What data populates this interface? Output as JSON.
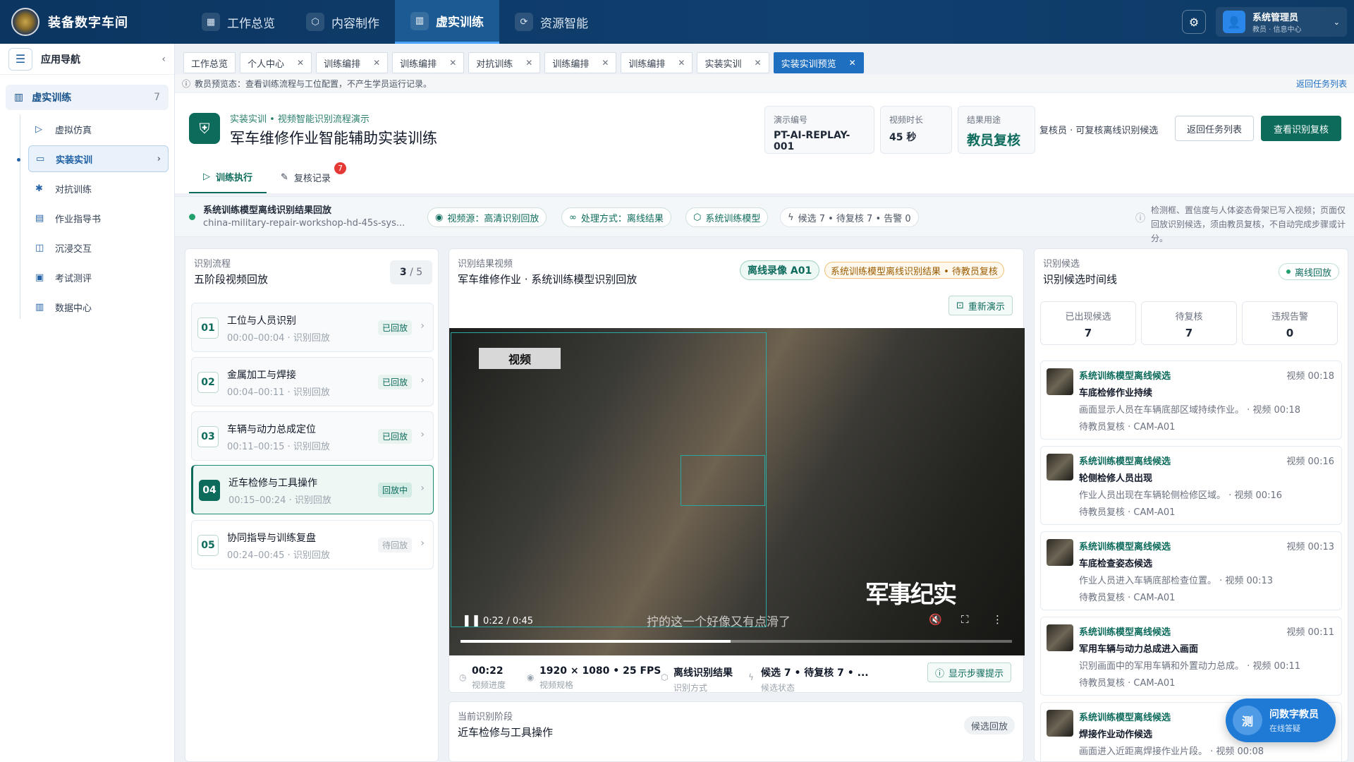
{
  "app": {
    "title": "装备数字车间"
  },
  "nav": [
    {
      "label": "工作总览",
      "icon": "grid-icon"
    },
    {
      "label": "内容制作",
      "icon": "cube-icon"
    },
    {
      "label": "虚实训练",
      "icon": "book-icon"
    },
    {
      "label": "资源智能",
      "icon": "ai-icon"
    }
  ],
  "user": {
    "name": "系统管理员",
    "role": "教员 · 信息中心"
  },
  "sidebar": {
    "title": "应用导航",
    "group": {
      "label": "虚实训练",
      "count": "7"
    },
    "items": [
      {
        "label": "虚拟仿真",
        "icon": "play-icon"
      },
      {
        "label": "实装实训",
        "icon": "monitor-icon"
      },
      {
        "label": "对抗训练",
        "icon": "target-icon"
      },
      {
        "label": "作业指导书",
        "icon": "doc-icon"
      },
      {
        "label": "沉浸交互",
        "icon": "vr-icon"
      },
      {
        "label": "考试测评",
        "icon": "clipboard-icon"
      },
      {
        "label": "数据中心",
        "icon": "chart-icon"
      }
    ]
  },
  "tabs": [
    "工作总览",
    "个人中心",
    "训练编排",
    "训练编排",
    "对抗训练",
    "训练编排",
    "训练编排",
    "实装实训",
    "实装实训预览"
  ],
  "notice": {
    "text": "教员预览态：查看训练流程与工位配置，不产生学员运行记录。",
    "return": "返回任务列表"
  },
  "hero": {
    "subtitle": "实装实训 • 视频智能识别流程演示",
    "title": "军车维修作业智能辅助实装训练",
    "stats": [
      {
        "label": "演示编号",
        "value": "PT-AI-REPLAY-001"
      },
      {
        "label": "视频时长",
        "value": "45 秒"
      },
      {
        "label": "结果用途",
        "value": "教员复核"
      }
    ],
    "role_text": "复核员 · 可复核离线识别候选",
    "btn_back": "返回任务列表",
    "btn_review": "查看识别复核",
    "subtabs": [
      {
        "label": "训练执行"
      },
      {
        "label": "复核记录",
        "badge": "7"
      }
    ]
  },
  "strip": {
    "title": "系统训练模型离线识别结果回放",
    "file": "china-military-repair-workshop-hd-45s-sys...",
    "chips": [
      "视频源：高清识别回放",
      "处理方式：离线结果",
      "系统训练模型",
      "候选 7 • 待复核 7 • 告警 0"
    ],
    "note": "检测框、置信度与人体姿态骨架已写入视频；页面仅回放识别候选，须由教员复核，不自动完成步骤或计分。"
  },
  "flow": {
    "label": "识别流程",
    "title": "五阶段视频回放",
    "progress": "3",
    "total": "/ 5",
    "steps": [
      {
        "n": "01",
        "t": "工位与人员识别",
        "s": "00:00–00:04 · 识别回放",
        "st": "已回放"
      },
      {
        "n": "02",
        "t": "金属加工与焊接",
        "s": "00:04–00:11 · 识别回放",
        "st": "已回放"
      },
      {
        "n": "03",
        "t": "车辆与动力总成定位",
        "s": "00:11–00:15 · 识别回放",
        "st": "已回放"
      },
      {
        "n": "04",
        "t": "近车检修与工具操作",
        "s": "00:15–00:24 · 识别回放",
        "st": "回放中"
      },
      {
        "n": "05",
        "t": "协同指导与训练复盘",
        "s": "00:24–00:45 · 识别回放",
        "st": "待回放"
      }
    ]
  },
  "video": {
    "label": "识别结果视频",
    "title": "军车维修作业 · 系统训练模型识别回放",
    "tag1": "离线录像 A01",
    "tag2": "系统训练模型离线识别结果 • 待教员复核",
    "replay": "重新演示",
    "time": "0:22 / 0:45",
    "progress": 0.49,
    "logo": "视频",
    "watermark": "军事纪实",
    "subtitle": "拧的这一个好像又有点滑了",
    "info": [
      {
        "v": "00:22",
        "l": "视频进度"
      },
      {
        "v": "1920 × 1080 • 25 FPS",
        "l": "视频规格"
      },
      {
        "v": "离线识别结果",
        "l": "识别方式"
      },
      {
        "v": "候选 7 • 待复核 7 • ...",
        "l": "候选状态"
      }
    ],
    "hint_btn": "显示步骤提示"
  },
  "stage": {
    "label": "当前识别阶段",
    "title": "近车检修与工具操作",
    "tag": "候选回放"
  },
  "cands": {
    "label": "识别候选",
    "title": "识别候选时间线",
    "tag": "离线回放",
    "mini": [
      {
        "l": "已出现候选",
        "v": "7"
      },
      {
        "l": "待复核",
        "v": "7"
      },
      {
        "l": "违规告警",
        "v": "0"
      }
    ],
    "items": [
      {
        "a": "系统训练模型离线候选",
        "b": "车底检修作业持续",
        "c": "画面显示人员在车辆底部区域持续作业。 · 视频 00:18",
        "d": "待教员复核 · CAM-A01",
        "tm": "视频 00:18"
      },
      {
        "a": "系统训练模型离线候选",
        "b": "轮侧检修人员出现",
        "c": "作业人员出现在车辆轮侧检修区域。 · 视频 00:16",
        "d": "待教员复核 · CAM-A01",
        "tm": "视频 00:16"
      },
      {
        "a": "系统训练模型离线候选",
        "b": "车底检查姿态候选",
        "c": "作业人员进入车辆底部检查位置。 · 视频 00:13",
        "d": "待教员复核 · CAM-A01",
        "tm": "视频 00:13"
      },
      {
        "a": "系统训练模型离线候选",
        "b": "军用车辆与动力总成进入画面",
        "c": "识别画面中的军用车辆和外置动力总成。 · 视频 00:11",
        "d": "待教员复核 · CAM-A01",
        "tm": "视频 00:11"
      },
      {
        "a": "系统训练模型离线候选",
        "b": "焊接作业动作候选",
        "c": "画面进入近距离焊接作业片段。 · 视频 00:08",
        "d": "",
        "tm": ""
      }
    ]
  },
  "assistant": {
    "icon": "测",
    "title": "问数字教员",
    "sub": "在线答疑"
  }
}
